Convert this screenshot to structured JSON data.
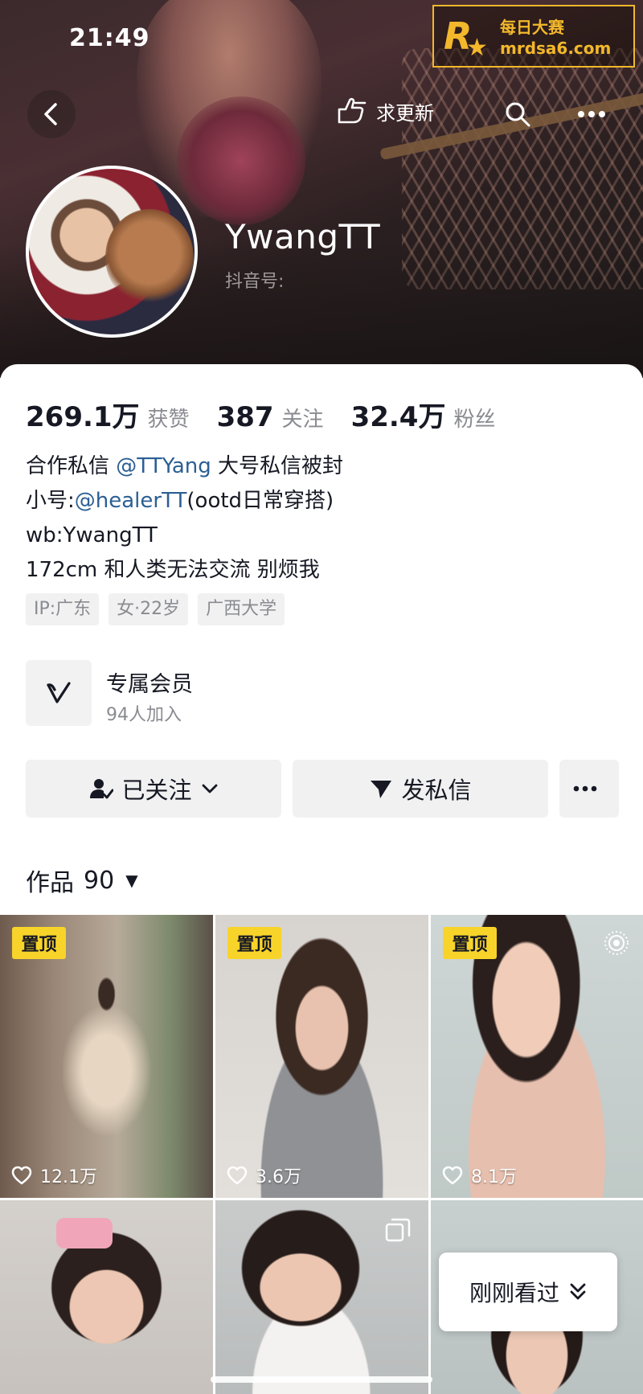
{
  "status_bar": {
    "time": "21:49"
  },
  "watermark": {
    "title": "每日大赛",
    "url": "mrdsa6.com"
  },
  "top_bar": {
    "request_update_label": "求更新"
  },
  "profile": {
    "nickname": "YwangTT",
    "douyin_id_label": "抖音号:",
    "stats": [
      {
        "value": "269.1万",
        "label": "获赞"
      },
      {
        "value": "387",
        "label": "关注"
      },
      {
        "value": "32.4万",
        "label": "粉丝"
      }
    ],
    "bio": {
      "line1_prefix": "合作私信 ",
      "line1_mention": "@TTYang",
      "line1_suffix": " 大号私信被封",
      "line2_prefix": "小号:",
      "line2_mention": "@healerTT",
      "line2_suffix": "(ootd日常穿搭)",
      "line3": "wb:YwangTT",
      "line4": "172cm 和人类无法交流 别烦我"
    },
    "tags": [
      "IP:广东",
      "女·22岁",
      "广西大学"
    ],
    "membership": {
      "title": "专属会员",
      "subtitle": "94人加入"
    }
  },
  "actions": {
    "follow_label": "已关注",
    "message_label": "发私信"
  },
  "works_tab": {
    "label": "作品",
    "count": "90"
  },
  "grid": {
    "pin_label": "置顶",
    "items": [
      {
        "likes": "12.1万",
        "pinned": true
      },
      {
        "likes": "3.6万",
        "pinned": true
      },
      {
        "likes": "8.1万",
        "pinned": true
      },
      {
        "likes": "",
        "pinned": false
      },
      {
        "likes": "",
        "pinned": false
      },
      {
        "likes": "",
        "pinned": false
      }
    ]
  },
  "recently_viewed_label": "刚刚看过",
  "colors": {
    "mention": "#2b5f94",
    "pin_badge": "#f8d42a",
    "watermark": "#f3b82b"
  }
}
